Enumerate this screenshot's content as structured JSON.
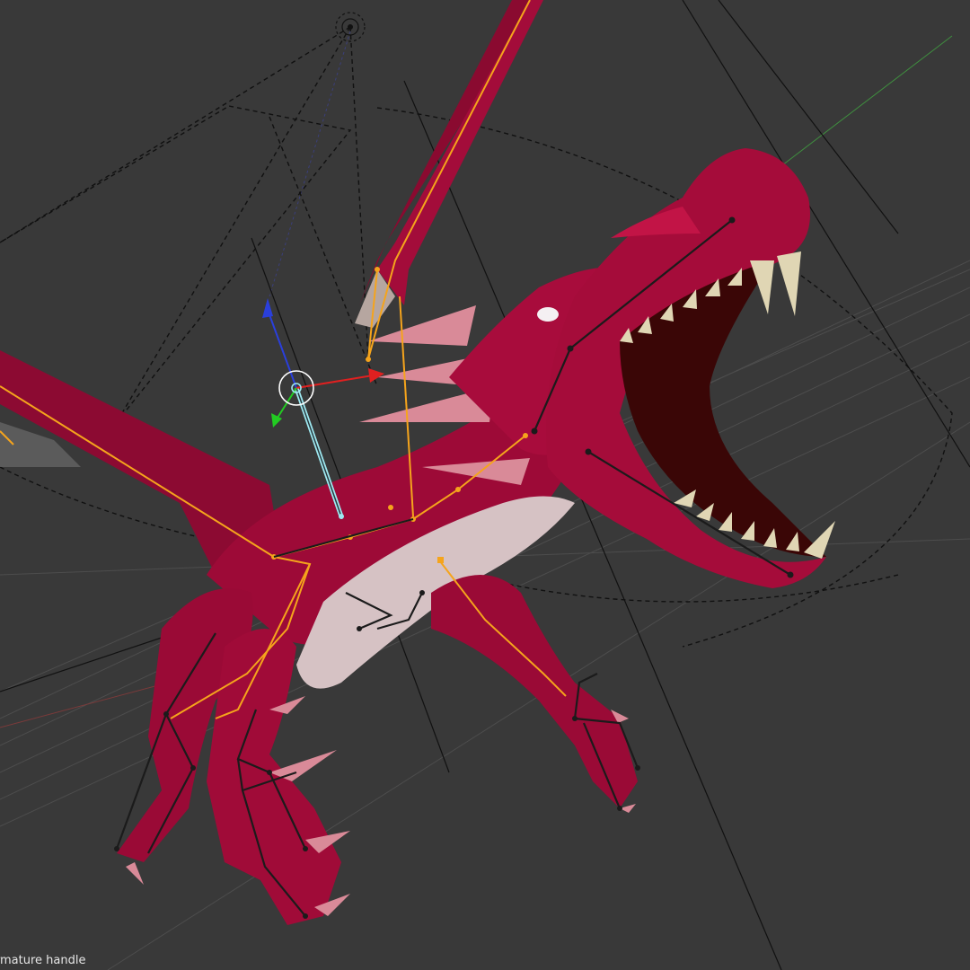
{
  "viewport": {
    "status_text": "Armature handle",
    "background_color": "#393939",
    "grid_color": "#4a4a4a",
    "mesh_color": "#9c0a36",
    "mesh_highlight_color": "#c41446",
    "belly_color": "#d8c4c4",
    "spike_color": "#d98a98",
    "teeth_color": "#e0d6b4",
    "mouth_inner_color": "#3a0606",
    "selected_bone_color": "#f5a41c",
    "active_bone_color": "#9ee8f0",
    "bone_color": "#1b1b1b",
    "gizmo": {
      "x_axis_color": "#e02020",
      "y_axis_color": "#22cc22",
      "z_axis_color": "#2a3fdc",
      "ring_color": "#ffffff"
    },
    "objects": [
      "dragon-mesh",
      "armature",
      "camera-frame",
      "lamp"
    ]
  }
}
